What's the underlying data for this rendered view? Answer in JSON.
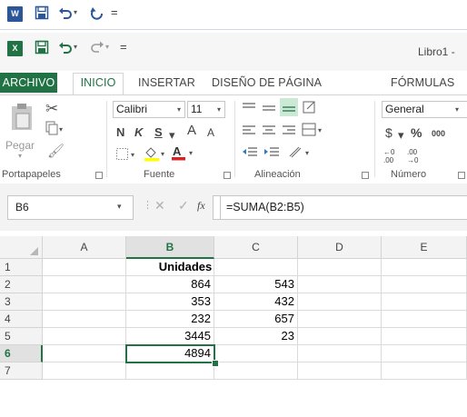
{
  "word_qat": {
    "logo": "W",
    "save_icon": "save-icon",
    "undo_icon": "undo-icon",
    "undo_caret": "▾",
    "redo_icon": "redo-icon",
    "customize": "="
  },
  "excel_qat": {
    "logo": "X",
    "save_icon": "save-icon",
    "undo_icon": "undo-icon",
    "undo_caret": "▾",
    "redo_icon": "redo-icon",
    "customize": "=",
    "title": "Libro1 -"
  },
  "tabs": [
    "ARCHIVO",
    "INICIO",
    "INSERTAR",
    "DISEÑO DE PÁGINA",
    "FÓRMULAS"
  ],
  "ribbon": {
    "portapapeles": {
      "label": "Portapapeles",
      "paste": "Pegar"
    },
    "fuente": {
      "label": "Fuente",
      "font_name": "Calibri",
      "font_size": "11",
      "bold": "N",
      "italic": "K",
      "underline": "S",
      "grow": "A",
      "shrink": "A"
    },
    "alineacion": {
      "label": "Alineación"
    },
    "numero": {
      "label": "Número",
      "format": "General",
      "currency": "$",
      "percent": "%",
      "thousands": "000",
      "inc_dec": "←0 .00",
      "dec_dec": ".00 →0"
    }
  },
  "formula_bar": {
    "name_box": "B6",
    "cancel": "✕",
    "enter": "✓",
    "fx": "fx",
    "formula": "=SUMA(B2:B5)"
  },
  "columns": [
    "A",
    "B",
    "C",
    "D",
    "E"
  ],
  "rows": [
    "1",
    "2",
    "3",
    "4",
    "5",
    "6",
    "7"
  ],
  "cells": {
    "B1": "Unidades",
    "B2": "864",
    "C2": "543",
    "B3": "353",
    "C3": "432",
    "B4": "232",
    "C4": "657",
    "B5": "3445",
    "C5": "23",
    "B6": "4894"
  },
  "colors": {
    "excel_green": "#217346",
    "word_blue": "#2b579a"
  }
}
